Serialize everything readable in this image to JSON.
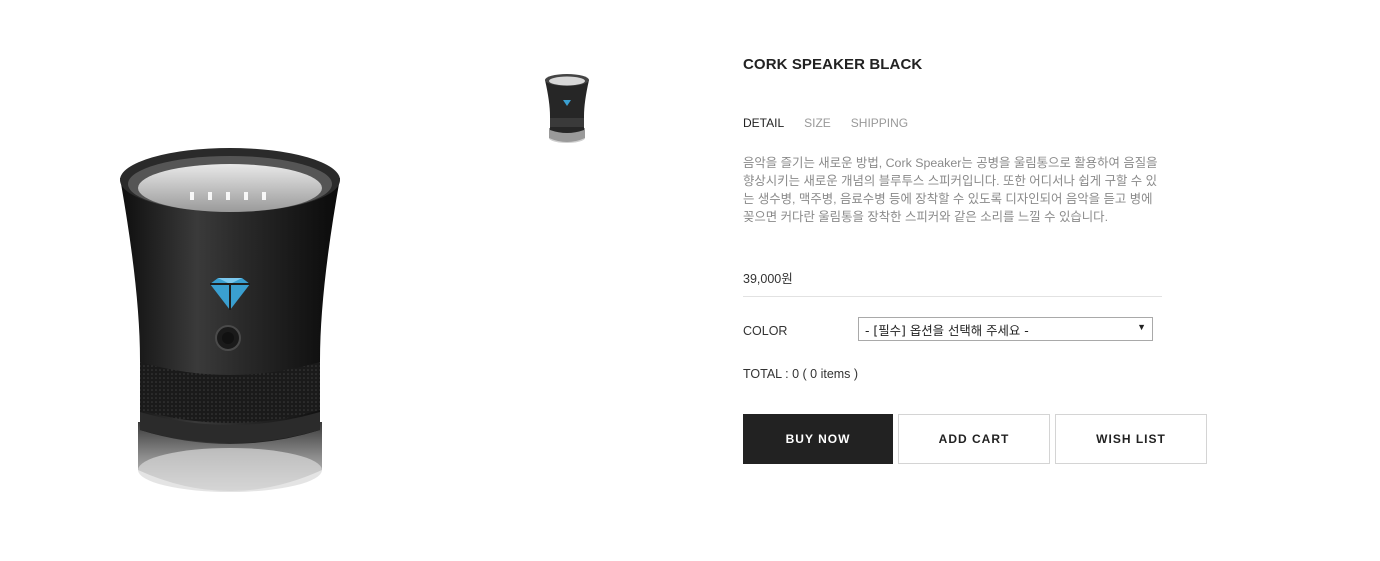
{
  "product": {
    "name": "CORK SPEAKER BLACK",
    "image_alt": "Cork speaker black product image",
    "thumbnail_alt": "Cork speaker thumbnail"
  },
  "tabs": [
    {
      "label": "DETAIL",
      "active": true
    },
    {
      "label": "SIZE",
      "active": false
    },
    {
      "label": "SHIPPING",
      "active": false
    }
  ],
  "description": [
    "음악을 즐기는 새로운 방법, Cork Speaker는 공병을 울림통으로 활용하여 음질을",
    "향상시키는 새로운 개념의 블루투스 스피커입니다. 또한 어디서나 쉽게 구할 수 있",
    "는 생수병, 맥주병, 음료수병 등에 장착할 수 있도록 디자인되어 음악을 듣고 병에",
    "꽂으면 커다란 울림통을 장착한 스피커와 같은 소리를 느낄 수 있습니다."
  ],
  "price": "39,000원",
  "option": {
    "label": "COLOR",
    "selected": "- [필수] 옵션을 선택해 주세요 -"
  },
  "total": "TOTAL : 0 ( 0 items )",
  "buttons": {
    "buy_now": "BUY NOW",
    "add_cart": "ADD CART",
    "wish_list": "WISH LIST"
  },
  "colors": {
    "accent_dark": "#222222",
    "body_black": "#1e1e1e",
    "logo_blue": "#3a9fd0",
    "muted_text": "#8a8a8a"
  },
  "icons": {
    "select_arrow": "triangle-down-icon",
    "logo": "diamond-logo-icon",
    "power": "power-button-icon"
  }
}
